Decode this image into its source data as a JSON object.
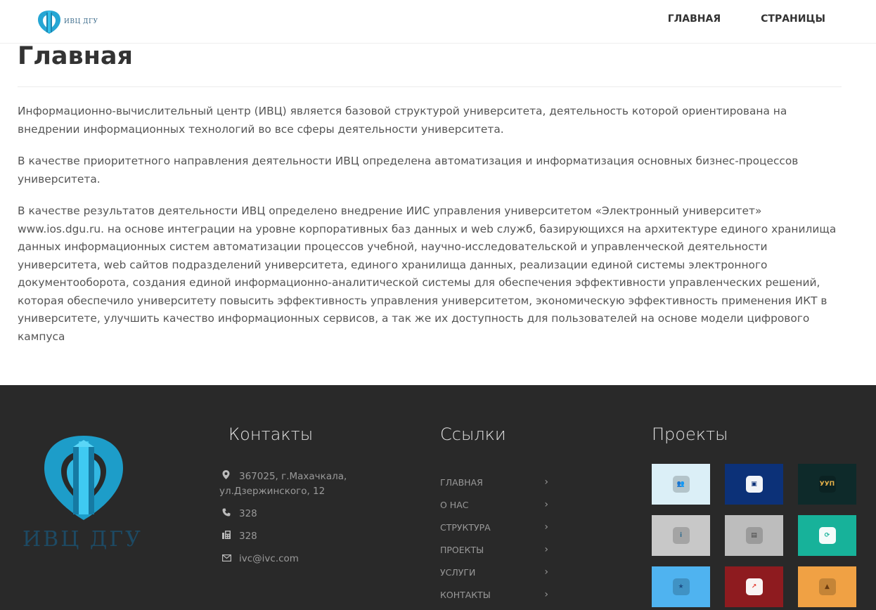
{
  "header": {
    "logo_text": "ИВЦ ДГУ",
    "nav": [
      {
        "label": "ГЛАВНАЯ"
      },
      {
        "label": "СТРАНИЦЫ"
      }
    ]
  },
  "main": {
    "title": "Главная",
    "paragraphs": [
      "Информационно-вычислительный центр (ИВЦ) является базовой структурой университета, деятельность которой ориентирована на внедрении информационных технологий во все сферы деятельности университета.",
      "В качестве приоритетного направления деятельности ИВЦ определена автоматизация и информатизация основных бизнес-процессов университета.",
      "В качестве результатов деятельности ИВЦ определено внедрение ИИС управления университетом «Электронный университет» www.ios.dgu.ru. на основе интеграции на уровне корпоративных баз данных и web служб, базирующихся на архитектуре единого хранилища данных информационных систем автоматизации процессов учебной, научно-исследовательской и управленческой деятельности университета, web сайтов подразделений университета, единого хранилища данных, реализации единой системы электронного документооборота, создания единой информационно-аналитической системы для обеспечения эффективности управленческих решений, которая обеспечило университету повысить эффективность управления университетом, экономическую эффективность применения ИКТ в университете, улучшить качество информационных сервисов, а так же их доступность для пользователей на основе модели цифрового кампуса"
    ]
  },
  "footer": {
    "logo_text": "ИВЦ ДГУ",
    "contacts": {
      "title": "Контакты",
      "address_line1": "367025, г.Махачкала,",
      "address_line2": "ул.Дзержинского, 12",
      "phone": "328",
      "fax": "328",
      "email": "ivc@ivc.com",
      "icons": [
        "map-marker-icon",
        "phone-icon",
        "fax-icon",
        "envelope-icon"
      ]
    },
    "links": {
      "title": "Ссылки",
      "items": [
        {
          "label": "ГЛАВНАЯ"
        },
        {
          "label": "О НАС"
        },
        {
          "label": "СТРУКТУРА"
        },
        {
          "label": "ПРОЕКТЫ"
        },
        {
          "label": "УСЛУГИ"
        },
        {
          "label": "КОНТАКТЫ"
        }
      ]
    },
    "projects": {
      "title": "Проекты",
      "tiles": [
        {
          "icon": "users-project-icon",
          "bg": "#dbeff7",
          "fg": "#1a8fc4",
          "glyph": "👥"
        },
        {
          "icon": "e-journal-project-icon",
          "bg": "#0c3178",
          "fg": "#ffffff",
          "glyph": "▣"
        },
        {
          "icon": "uup-project-icon",
          "bg": "#0e2a2a",
          "fg": "#e6b24a",
          "glyph": "УУП"
        },
        {
          "icon": "people-info-project-icon",
          "bg": "#c8c8c8",
          "fg": "#2f6b8f",
          "glyph": "i"
        },
        {
          "icon": "presentation-project-icon",
          "bg": "#bdbdbd",
          "fg": "#444444",
          "glyph": "▤"
        },
        {
          "icon": "refresh-doc-project-icon",
          "bg": "#17b29a",
          "fg": "#ffffff",
          "glyph": "⟳"
        },
        {
          "icon": "star-badge-project-icon",
          "bg": "#4fb3f0",
          "fg": "#1c4e86",
          "glyph": "★"
        },
        {
          "icon": "arrow-up-project-icon",
          "bg": "#8e1b1f",
          "fg": "#e23a30",
          "glyph": "↗"
        },
        {
          "icon": "graduation-project-icon",
          "bg": "#f0a144",
          "fg": "#6b3c10",
          "glyph": "▲"
        }
      ]
    }
  }
}
